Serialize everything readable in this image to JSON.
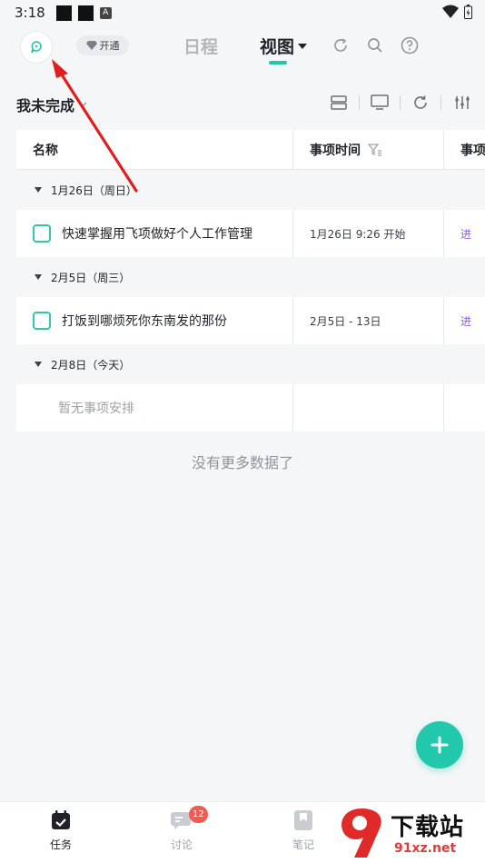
{
  "status_bar": {
    "time": "3:18",
    "notif_letter": "A"
  },
  "header": {
    "vip_label": "开通",
    "tabs": [
      {
        "label": "日程"
      },
      {
        "label": "视图"
      }
    ]
  },
  "toolbar": {
    "filter_label": "我未完成"
  },
  "table": {
    "columns": [
      "名称",
      "事项时间",
      "事项"
    ],
    "groups": [
      {
        "label": "1月26日（周日）",
        "tasks": [
          {
            "title": "快速掌握用飞项做好个人工作管理",
            "time": "1月26日 9:26 开始",
            "extra": "进"
          }
        ]
      },
      {
        "label": "2月5日（周三）",
        "tasks": [
          {
            "title": "打饭到哪烦死你东南发的那份",
            "time": "2月5日 - 13日",
            "extra": "进"
          }
        ]
      },
      {
        "label": "2月8日（今天）",
        "empty": "暂无事项安排"
      }
    ]
  },
  "no_more": "没有更多数据了",
  "bottom_nav": {
    "items": [
      {
        "label": "任务",
        "active": true
      },
      {
        "label": "讨论",
        "badge": "12"
      },
      {
        "label": "笔记"
      }
    ]
  },
  "watermark": {
    "top": "下载站",
    "bottom": "91xz.net"
  },
  "colors": {
    "accent": "#21c8ac",
    "purple": "#8c5cf0",
    "badge": "#f25a54",
    "arrow": "#e01e1e"
  }
}
